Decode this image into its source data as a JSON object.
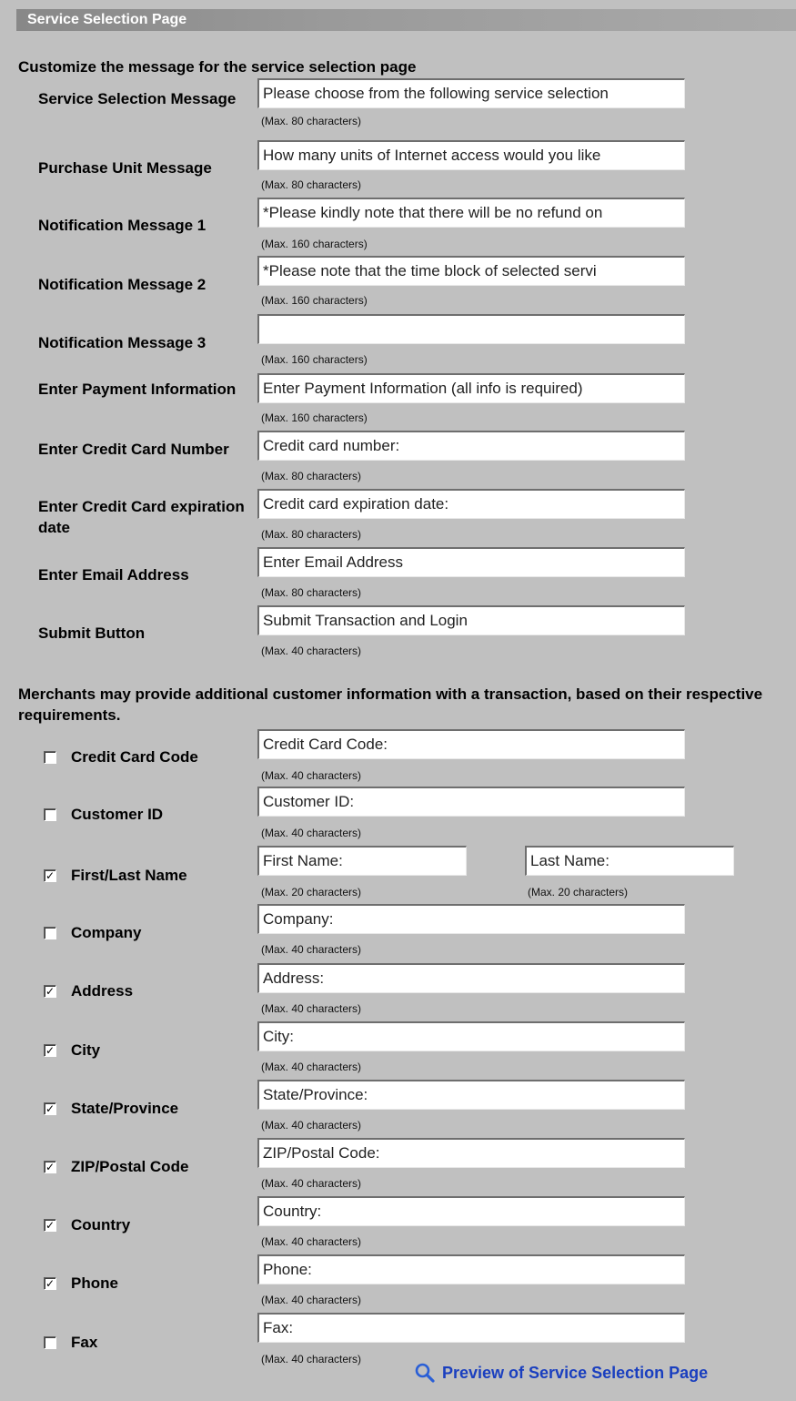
{
  "page_title": "Service Selection Page",
  "section1_heading": "Customize the message for the service selection page",
  "messages": [
    {
      "label": "Service Selection Message",
      "value": "Please choose from the following service selection",
      "hint": "(Max. 80 characters)"
    },
    {
      "label": "Purchase Unit Message",
      "value": "How many units of Internet access would you like",
      "hint": "(Max. 80 characters)"
    },
    {
      "label": "Notification Message 1",
      "value": "*Please kindly note that there will be no refund on",
      "hint": "(Max. 160 characters)"
    },
    {
      "label": "Notification Message 2",
      "value": "*Please note that the time block of selected servi",
      "hint": "(Max. 160 characters)"
    },
    {
      "label": "Notification Message 3",
      "value": "",
      "hint": "(Max. 160 characters)"
    },
    {
      "label": "Enter Payment Information",
      "value": "Enter Payment Information (all info is required)",
      "hint": "(Max. 160 characters)"
    },
    {
      "label": "Enter Credit Card Number",
      "value": "Credit card number:",
      "hint": "(Max. 80 characters)"
    },
    {
      "label": "Enter Credit Card expiration date",
      "value": "Credit card expiration date:",
      "hint": "(Max. 80 characters)"
    },
    {
      "label": "Enter Email Address",
      "value": "Enter Email Address",
      "hint": "(Max. 80 characters)"
    },
    {
      "label": "Submit Button",
      "value": "Submit Transaction and Login",
      "hint": "(Max. 40 characters)"
    }
  ],
  "section2_heading": "Merchants may provide additional customer information with a transaction, based on their respective requirements.",
  "customer_fields": [
    {
      "label": "Credit Card Code",
      "checked": false,
      "value": "Credit Card Code:",
      "hint": "(Max. 40 characters)"
    },
    {
      "label": "Customer ID",
      "checked": false,
      "value": "Customer ID:",
      "hint": "(Max. 40 characters)"
    },
    {
      "label": "First/Last Name",
      "checked": true,
      "value": "First Name:",
      "hint": "(Max. 20 characters)",
      "value2": "Last Name:",
      "hint2": "(Max. 20 characters)"
    },
    {
      "label": "Company",
      "checked": false,
      "value": "Company:",
      "hint": "(Max. 40 characters)"
    },
    {
      "label": "Address",
      "checked": true,
      "value": "Address:",
      "hint": "(Max. 40 characters)"
    },
    {
      "label": "City",
      "checked": true,
      "value": "City:",
      "hint": "(Max. 40 characters)"
    },
    {
      "label": "State/Province",
      "checked": true,
      "value": "State/Province:",
      "hint": "(Max. 40 characters)"
    },
    {
      "label": "ZIP/Postal Code",
      "checked": true,
      "value": "ZIP/Postal Code:",
      "hint": "(Max. 40 characters)"
    },
    {
      "label": "Country",
      "checked": true,
      "value": "Country:",
      "hint": "(Max. 40 characters)"
    },
    {
      "label": "Phone",
      "checked": true,
      "value": "Phone:",
      "hint": "(Max. 40 characters)"
    },
    {
      "label": "Fax",
      "checked": false,
      "value": "Fax:",
      "hint": "(Max. 40 characters)"
    }
  ],
  "preview_link": "Preview of Service Selection Page",
  "icons": {
    "preview": "magnifier-icon",
    "checkbox_checked": "checkmark-icon"
  },
  "colors": {
    "background": "#c0c0c0",
    "link": "#1a3fbf",
    "titlebar": "#999999"
  }
}
